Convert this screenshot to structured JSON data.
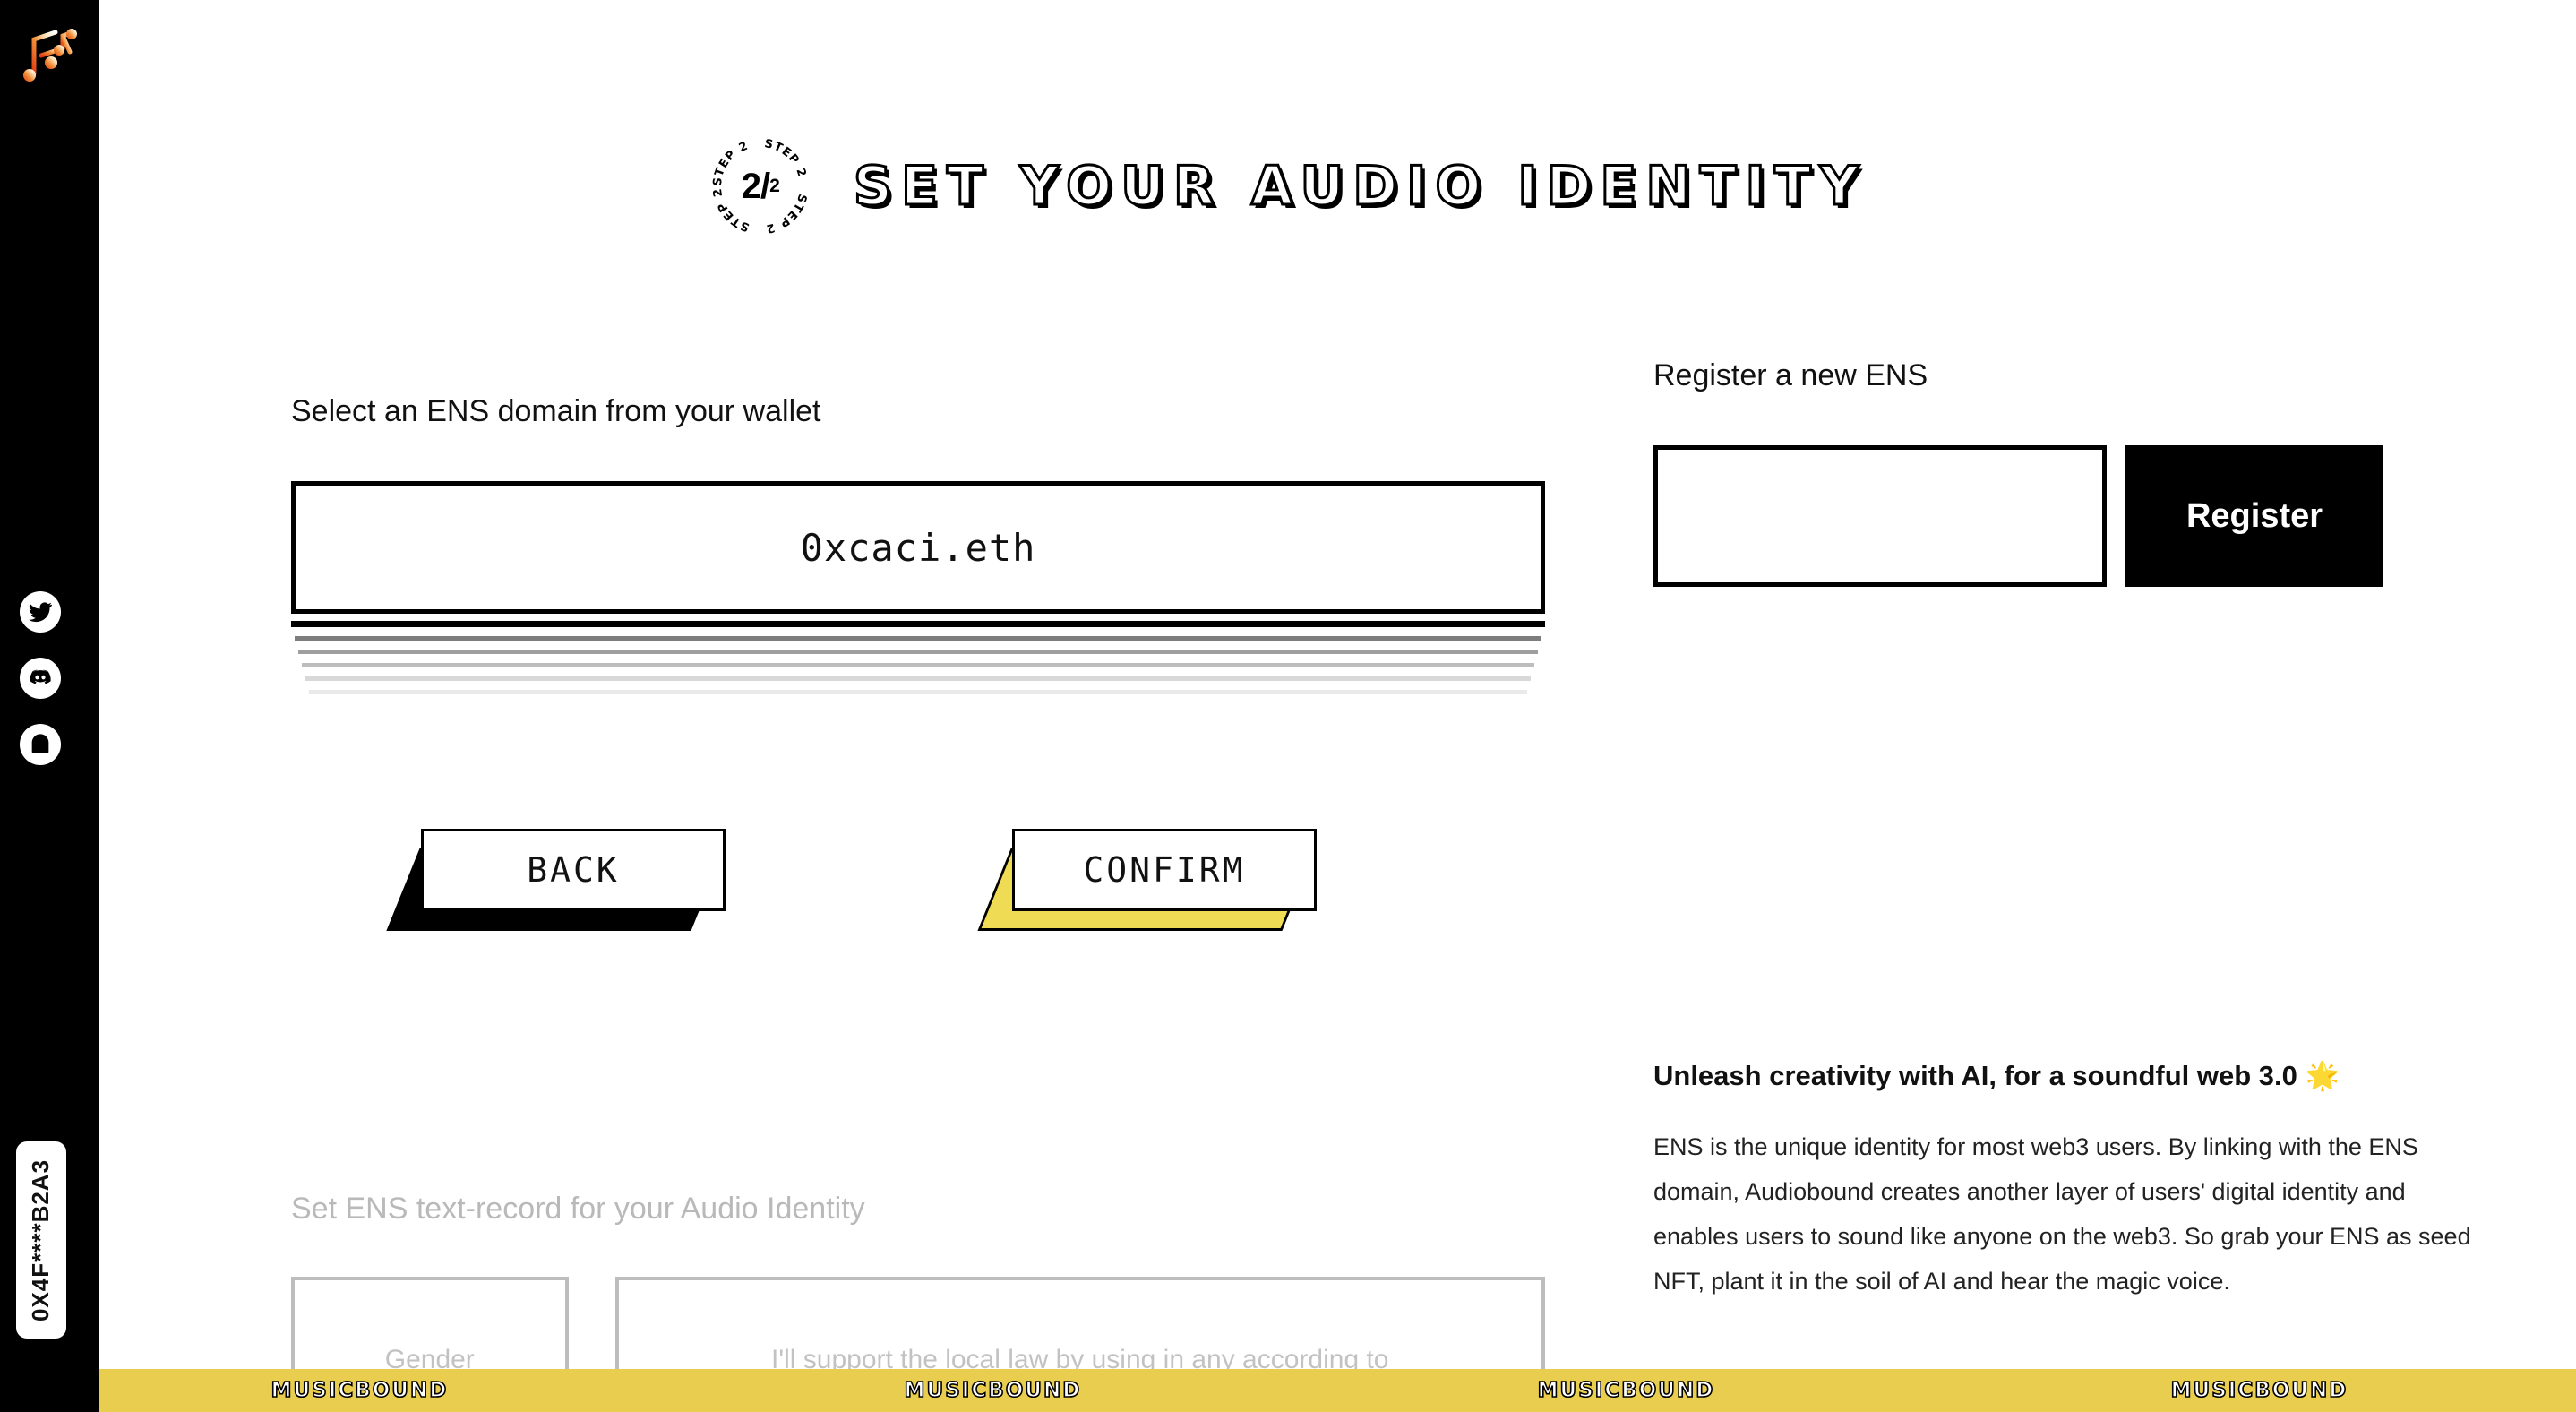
{
  "sidebar": {
    "logo_icon": "music-note-logo-icon",
    "socials": [
      {
        "name": "twitter",
        "icon": "twitter-icon"
      },
      {
        "name": "discord",
        "icon": "discord-icon"
      },
      {
        "name": "mirror",
        "icon": "mirror-icon"
      }
    ],
    "wallet_address": "0X4F****B2A3"
  },
  "header": {
    "step_badge_ring": "STEP 2",
    "step_current": "2",
    "step_total": "2",
    "title": "SET YOUR AUDIO IDENTITY"
  },
  "left": {
    "select_label": "Select an ENS domain from your wallet",
    "selected_ens": "0xcaci.eth",
    "stack_row_count": 6,
    "buttons": {
      "back": "BACK",
      "confirm": "CONFIRM"
    },
    "textrecord": {
      "label": "Set ENS text-record for your Audio Identity",
      "field_small_text": "Gender",
      "field_large_text": "I'll support the local law by using in any according to"
    }
  },
  "right": {
    "register_heading": "Register a new ENS",
    "ens_input_value": "",
    "ens_input_placeholder": "",
    "register_button": "Register",
    "promo_title": "Unleash creativity with AI, for a soundful web 3.0 🌟",
    "promo_body": "ENS is the unique identity for most web3 users. By linking with the ENS domain, Audiobound creates another layer of users' digital identity and enables users to sound like anyone on the web3. So grab your ENS as seed NFT, plant it in the soil of AI and hear the magic voice."
  },
  "marquee": {
    "items": [
      "MUSICBOUND",
      "MUSICBOUND",
      "MUSICBOUND",
      "MUSICBOUND"
    ]
  },
  "colors": {
    "accent_yellow": "#e8cd4e",
    "confirm_shadow": "#f0db54",
    "black": "#000000",
    "disabled_grey": "#bdbdbd",
    "disabled_text": "#b9b9b9"
  }
}
